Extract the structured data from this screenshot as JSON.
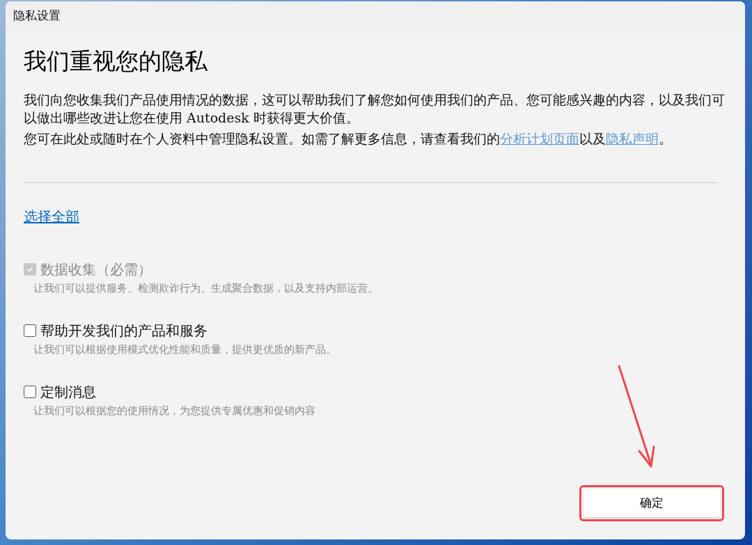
{
  "window": {
    "title": "隐私设置"
  },
  "heading": "我们重视您的隐私",
  "intro": "我们向您收集我们产品使用情况的数据，这可以帮助我们了解您如何使用我们的产品、您可能感兴趣的内容，以及我们可以做出哪些改进让您在使用 Autodesk 时获得更大价值。",
  "manage_text": {
    "before": "您可在此处或随时在个人资料中管理隐私设置。如需了解更多信息，请查看我们的",
    "link_1": "分析计划页面",
    "middle": "以及",
    "link_2": "隐私声明",
    "after": "。"
  },
  "select_all": "选择全部",
  "options": [
    {
      "label": "数据收集（必需）",
      "description": "让我们可以提供服务、检测欺诈行为、生成聚合数据，以及支持内部运营。",
      "checked": true,
      "disabled": true
    },
    {
      "label": "帮助开发我们的产品和服务",
      "description": "让我们可以根据使用模式优化性能和质量，提供更优质的新产品。",
      "checked": false,
      "disabled": false
    },
    {
      "label": "定制消息",
      "description": "让我们可以根据您的使用情况，为您提供专属优惠和促销内容",
      "checked": false,
      "disabled": false
    }
  ],
  "ok_button": "确定"
}
